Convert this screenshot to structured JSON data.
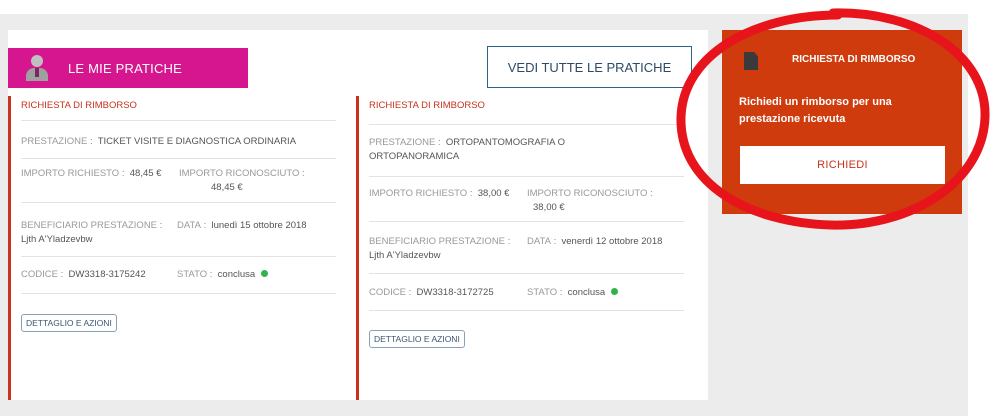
{
  "header": {
    "mie_pratiche_label": "LE MIE PRATICHE",
    "vedi_tutte_label": "VEDI TUTTE LE PRATICHE"
  },
  "cards": [
    {
      "title": "RICHIESTA DI RIMBORSO",
      "prestazione_label": "PRESTAZIONE",
      "prestazione_value": "TICKET VISITE E DIAGNOSTICA ORDINARIA",
      "importo_richiesto_label": "IMPORTO RICHIESTO",
      "importo_richiesto_value": "48,45 €",
      "importo_riconosciuto_label": "IMPORTO RICONOSCIUTO",
      "importo_riconosciuto_value": "48,45 €",
      "beneficiario_label": "BENEFICIARIO PRESTAZIONE",
      "beneficiario_value": "Ljth A'Yladzevbw",
      "data_label": "DATA",
      "data_value": "lunedì 15 ottobre 2018",
      "codice_label": "CODICE",
      "codice_value": "DW3318-3175242",
      "stato_label": "STATO",
      "stato_value": "conclusa",
      "button_label": "DETTAGLIO E AZIONI"
    },
    {
      "title": "RICHIESTA DI RIMBORSO",
      "prestazione_label": "PRESTAZIONE",
      "prestazione_value": "ORTOPANTOMOGRAFIA O ORTOPANORAMICA",
      "importo_richiesto_label": "IMPORTO RICHIESTO",
      "importo_richiesto_value": "38,00 €",
      "importo_riconosciuto_label": "IMPORTO RICONOSCIUTO",
      "importo_riconosciuto_value": "38,00 €",
      "beneficiario_label": "BENEFICIARIO PRESTAZIONE",
      "beneficiario_value": "Ljth A'Yladzevbw",
      "data_label": "DATA",
      "data_value": "venerdì 12 ottobre 2018",
      "codice_label": "CODICE",
      "codice_value": "DW3318-3172725",
      "stato_label": "STATO",
      "stato_value": "conclusa",
      "button_label": "DETTAGLIO E AZIONI"
    }
  ],
  "side_panel": {
    "title": "RICHIESTA DI RIMBORSO",
    "description": "Richiedi un rimborso per una prestazione ricevuta",
    "button_label": "RICHIEDI",
    "icon": "document-icon"
  },
  "colors": {
    "accent_magenta": "#d6168f",
    "accent_red": "#c8321e",
    "side_panel_orange": "#cf3b0d",
    "status_green": "#2fb34a",
    "annotation_red": "#e8141c"
  }
}
